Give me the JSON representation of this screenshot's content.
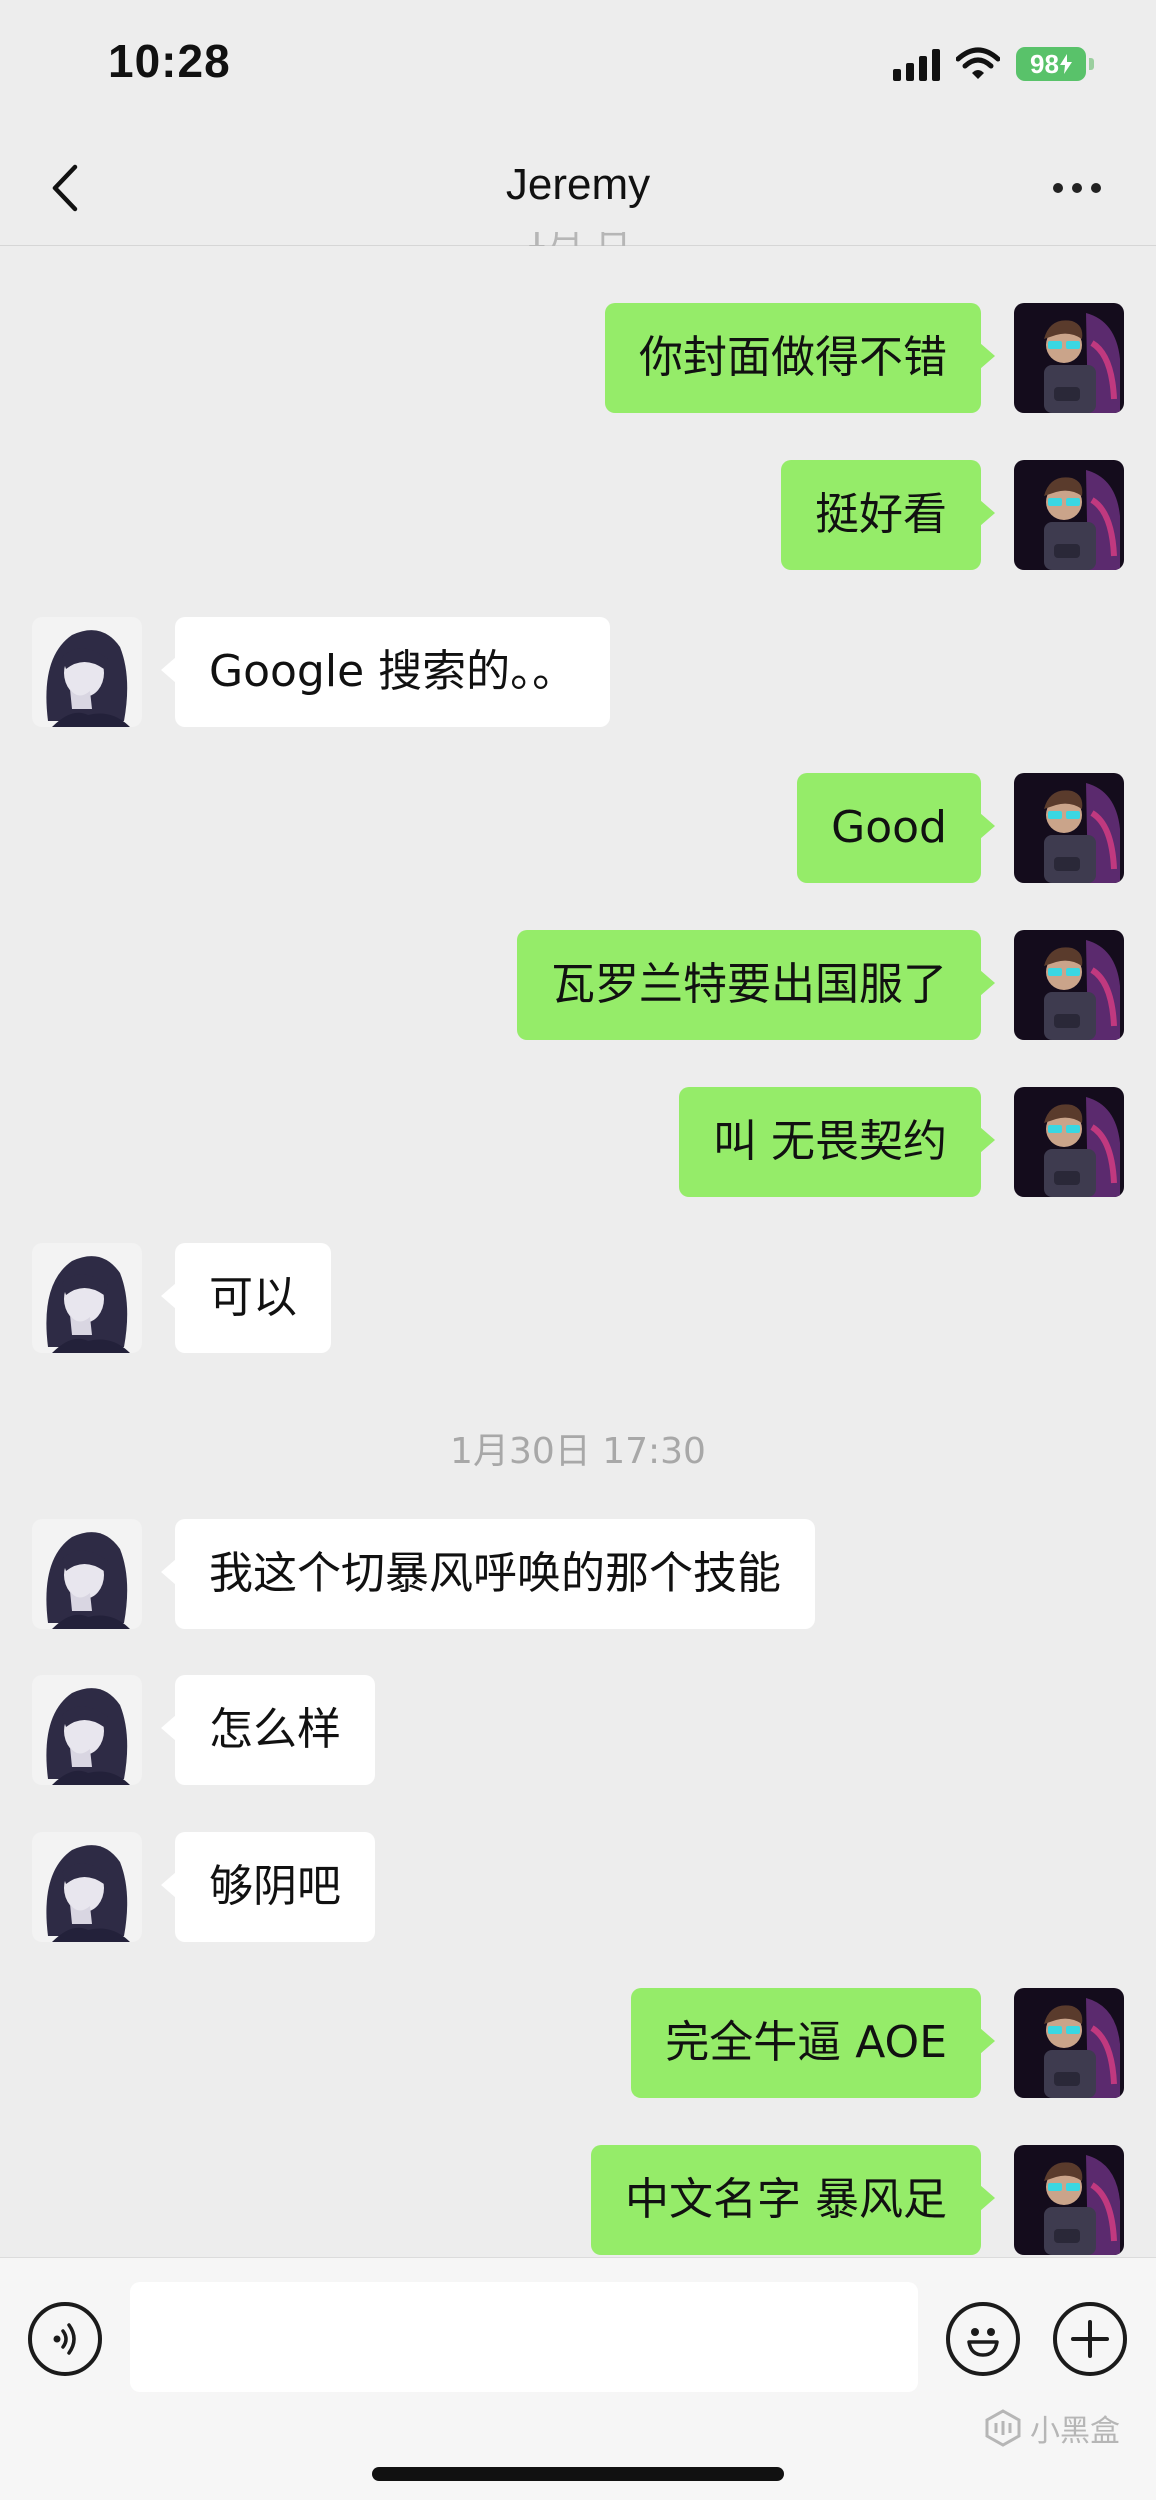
{
  "status_bar": {
    "time": "10:28",
    "battery": "98"
  },
  "header": {
    "title": "Jeremy",
    "earlier_timestamp_partial": "1月 日 "
  },
  "messages": [
    {
      "from": "self",
      "text": "你封面做得不错"
    },
    {
      "from": "self",
      "text": "挺好看"
    },
    {
      "from": "other",
      "text": "Google 搜索的。。"
    },
    {
      "from": "self",
      "text": "Good"
    },
    {
      "from": "self",
      "text": "瓦罗兰特要出国服了"
    },
    {
      "from": "self",
      "text": "叫 无畏契约"
    },
    {
      "from": "other",
      "text": "可以"
    },
    {
      "from": "other",
      "text": "我这个切暴风呼唤的那个技能"
    },
    {
      "from": "other",
      "text": "怎么样"
    },
    {
      "from": "other",
      "text": "够阴吧"
    },
    {
      "from": "self",
      "text": "完全牛逼 AOE"
    },
    {
      "from": "self",
      "text": "中文名字 暴风足"
    }
  ],
  "time_divider": "1月30日 17:30",
  "input_bar": {
    "value": "",
    "placeholder": ""
  },
  "watermark": "小黑盒",
  "colors": {
    "self_bubble": "#95ec69",
    "other_bubble": "#ffffff",
    "background": "#ededed",
    "battery": "#59c26a"
  },
  "icons": [
    "back-chevron-icon",
    "more-dots-icon",
    "voice-icon",
    "emoji-icon",
    "plus-icon",
    "signal-icon",
    "wifi-icon",
    "battery-icon"
  ]
}
